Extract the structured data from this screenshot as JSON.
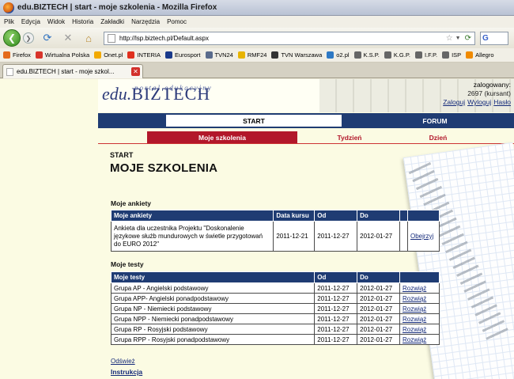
{
  "window": {
    "title": "edu.BIZTECH | start - moje szkolenia - Mozilla Firefox"
  },
  "menu": [
    "Plik",
    "Edycja",
    "Widok",
    "Historia",
    "Zakładki",
    "Narzędzia",
    "Pomoc"
  ],
  "url": "http://lsp.biztech.pl/Default.aspx",
  "search_engine": "G",
  "bookmarks": [
    {
      "label": "Firefox",
      "color": "#e46a1b"
    },
    {
      "label": "Wirtualna Polska",
      "color": "#d8342a"
    },
    {
      "label": "Onet.pl",
      "color": "#f2a900"
    },
    {
      "label": "INTERIA",
      "color": "#e0301e"
    },
    {
      "label": "Eurosport",
      "color": "#1a3a8a"
    },
    {
      "label": "TVN24",
      "color": "#5a6b8c"
    },
    {
      "label": "RMF24",
      "color": "#e8b400"
    },
    {
      "label": "TVN Warszawa",
      "color": "#333"
    },
    {
      "label": "o2.pl",
      "color": "#2e79c4"
    },
    {
      "label": "K.S.P.",
      "color": "#666"
    },
    {
      "label": "K.G.P.",
      "color": "#666"
    },
    {
      "label": "I.F.P.",
      "color": "#666"
    },
    {
      "label": "ISP",
      "color": "#666"
    },
    {
      "label": "Allegro",
      "color": "#f08a00"
    }
  ],
  "tab": {
    "label": "edu.BIZTECH | start - moje szkol..."
  },
  "site": {
    "logo_main": "edu.",
    "logo_brand": "BIZTECH",
    "tagline": "portal edukacyjny",
    "logged_label": "zalogowany:",
    "user": "2697 (kursant)",
    "links": [
      "Zaloguj",
      "Wyloguj",
      "Hasło"
    ]
  },
  "nav": {
    "start": "START",
    "forum": "FORUM"
  },
  "subnav": {
    "moje": "Moje szkolenia",
    "tydzien": "Tydzień",
    "dzien": "Dzień"
  },
  "breadcrumb": "START",
  "page_title": "MOJE SZKOLENIA",
  "ankiety": {
    "section": "Moje ankiety",
    "headers": [
      "Moje ankiety",
      "Data kursu",
      "Od",
      "Do",
      "",
      ""
    ],
    "rows": [
      [
        "Ankieta dla uczestnika Projektu \"Doskonalenie językowe służb mundurowych w świetle przygotowań do EURO 2012\"",
        "2011-12-21",
        "2011-12-27",
        "2012-01-27",
        "",
        "Obejrzyj"
      ]
    ]
  },
  "testy": {
    "section": "Moje testy",
    "headers": [
      "Moje testy",
      "Od",
      "Do",
      ""
    ],
    "rows": [
      [
        "Grupa AP - Angielski podstawowy",
        "2011-12-27",
        "2012-01-27",
        "Rozwiąż"
      ],
      [
        "Grupa APP- Angielski ponadpodstawowy",
        "2011-12-27",
        "2012-01-27",
        "Rozwiąż"
      ],
      [
        "Grupa NP - Niemiecki podstawowy",
        "2011-12-27",
        "2012-01-27",
        "Rozwiąż"
      ],
      [
        "Grupa NPP - Niemiecki ponadpodstawowy",
        "2011-12-27",
        "2012-01-27",
        "Rozwiąż"
      ],
      [
        "Grupa RP - Rosyjski podstawowy",
        "2011-12-27",
        "2012-01-27",
        "Rozwiąż"
      ],
      [
        "Grupa RPP - Rosyjski ponadpodstawowy",
        "2011-12-27",
        "2012-01-27",
        "Rozwiąż"
      ]
    ]
  },
  "refresh": "Odśwież",
  "instrukcja": "Instrukcja"
}
